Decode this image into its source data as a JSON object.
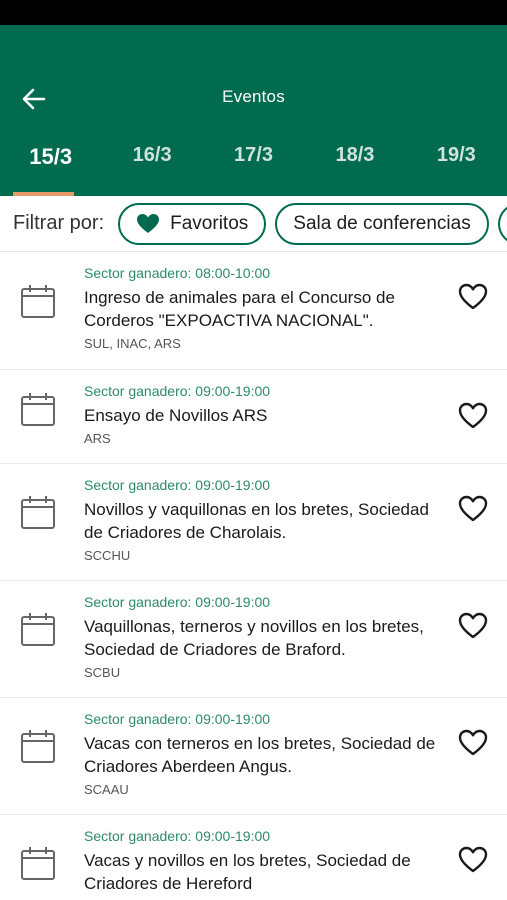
{
  "header": {
    "title": "Eventos",
    "back_icon": "arrow-left-icon"
  },
  "dates": [
    {
      "label": "15/3",
      "active": true
    },
    {
      "label": "16/3",
      "active": false
    },
    {
      "label": "17/3",
      "active": false
    },
    {
      "label": "18/3",
      "active": false
    },
    {
      "label": "19/3",
      "active": false
    }
  ],
  "filter": {
    "label": "Filtrar por:",
    "chips": [
      {
        "label": "Favoritos",
        "icon": "heart-filled-icon"
      },
      {
        "label": "Sala de conferencias"
      }
    ]
  },
  "events": [
    {
      "meta": "Sector ganadero: 08:00-10:00",
      "title": "Ingreso de animales para el Concurso de Corderos \"EXPOACTIVA NACIONAL\".",
      "org": "SUL, INAC, ARS"
    },
    {
      "meta": "Sector ganadero: 09:00-19:00",
      "title": "Ensayo de Novillos ARS",
      "org": "ARS"
    },
    {
      "meta": "Sector ganadero: 09:00-19:00",
      "title": "Novillos y vaquillonas en los bretes, Sociedad de Criadores de Charolais.",
      "org": "SCCHU"
    },
    {
      "meta": "Sector ganadero: 09:00-19:00",
      "title": "Vaquillonas, terneros y novillos en los bretes, Sociedad de Criadores de Braford.",
      "org": "SCBU"
    },
    {
      "meta": "Sector ganadero: 09:00-19:00",
      "title": "Vacas con terneros en los bretes, Sociedad de Criadores Aberdeen Angus.",
      "org": "SCAAU"
    },
    {
      "meta": "Sector ganadero: 09:00-19:00",
      "title": "Vacas y novillos en los bretes, Sociedad de Criadores de Hereford",
      "org": ""
    }
  ],
  "colors": {
    "primary": "#006b4f",
    "accent": "#e89a6a",
    "meta_text": "#2d8a6a"
  }
}
